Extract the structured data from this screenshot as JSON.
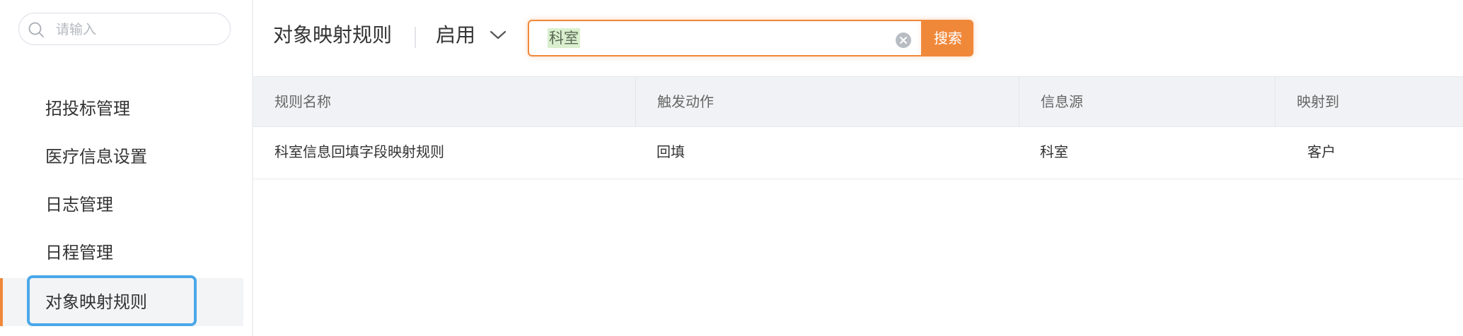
{
  "sidebar": {
    "search": {
      "placeholder": "请输入",
      "value": ""
    },
    "items": [
      {
        "label": "招投标管理",
        "active": false
      },
      {
        "label": "医疗信息设置",
        "active": false
      },
      {
        "label": "日志管理",
        "active": false
      },
      {
        "label": "日程管理",
        "active": false
      },
      {
        "label": "对象映射规则",
        "active": true
      }
    ]
  },
  "header": {
    "title": "对象映射规则",
    "status_filter": {
      "selected": "启用",
      "icon": "chevron-down-icon"
    },
    "search": {
      "query": "科室",
      "button_label": "搜索",
      "clear_icon": "clear-circle-icon"
    }
  },
  "table": {
    "columns": [
      "规则名称",
      "触发动作",
      "信息源",
      "映射到"
    ],
    "rows": [
      [
        "科室信息回填字段映射规则",
        "回填",
        "科室",
        "客户"
      ]
    ]
  },
  "colors": {
    "accent": "#f0883a",
    "focus_ring": "#4aa8e8",
    "header_bg": "#f1f2f5",
    "query_highlight": "#d9efce"
  }
}
